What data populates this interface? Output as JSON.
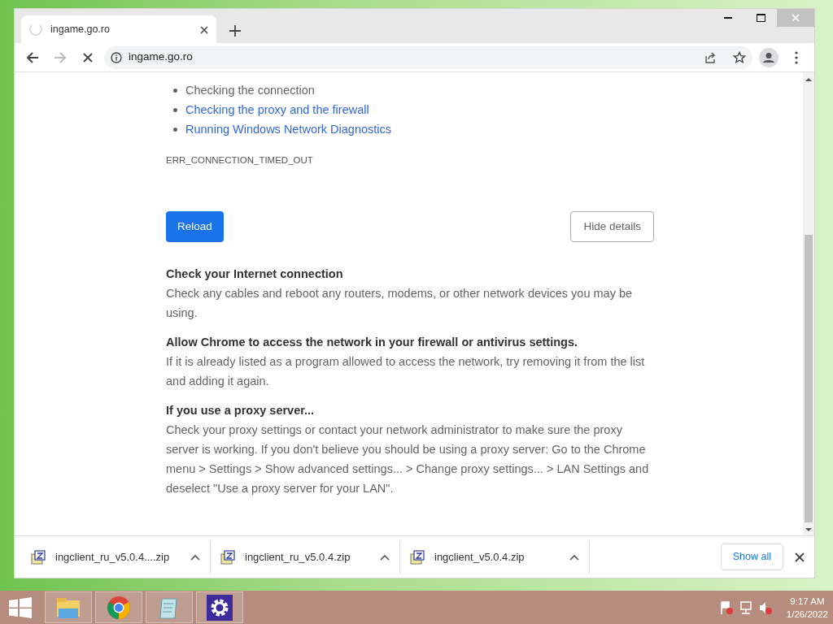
{
  "tabs": [
    {
      "title": "ingame.go.ro",
      "loading": true,
      "selected": true
    }
  ],
  "address_bar": {
    "url": "ingame.go.ro"
  },
  "page": {
    "suggestions": [
      {
        "text": "Checking the connection",
        "kind": "plain"
      },
      {
        "text": "Checking the proxy and the firewall",
        "kind": "link"
      },
      {
        "text": "Running Windows Network Diagnostics",
        "kind": "link"
      }
    ],
    "error_code": "ERR_CONNECTION_TIMED_OUT",
    "reload_button": "Reload",
    "details_button": "Hide details",
    "sections": [
      {
        "heading": "Check your Internet connection",
        "body": "Check any cables and reboot any routers, modems, or other network devices you may be using."
      },
      {
        "heading": "Allow Chrome to access the network in your firewall or antivirus settings.",
        "body": "If it is already listed as a program allowed to access the network, try removing it from the list and adding it again."
      },
      {
        "heading": "If you use a proxy server...",
        "body": "Check your proxy settings or contact your network administrator to make sure the proxy server is working. If you don't believe you should be using a proxy server: Go to the Chrome menu > Settings > Show advanced settings... > Change proxy settings... > LAN Settings and deselect \"Use a proxy server for your LAN\"."
      }
    ]
  },
  "downloads": [
    {
      "filename": "ingclient_ru_v5.0.4....zip"
    },
    {
      "filename": "ingclient_ru_v5.0.4.zip"
    },
    {
      "filename": "ingclient_v5.0.4.zip"
    }
  ],
  "show_all_button": "Show all",
  "taskbar": {
    "apps": [
      {
        "kind": "explorer"
      },
      {
        "kind": "browser"
      },
      {
        "kind": "notepad"
      },
      {
        "kind": "settings"
      }
    ],
    "time": "9:17 AM",
    "date": "1/26/2022"
  }
}
